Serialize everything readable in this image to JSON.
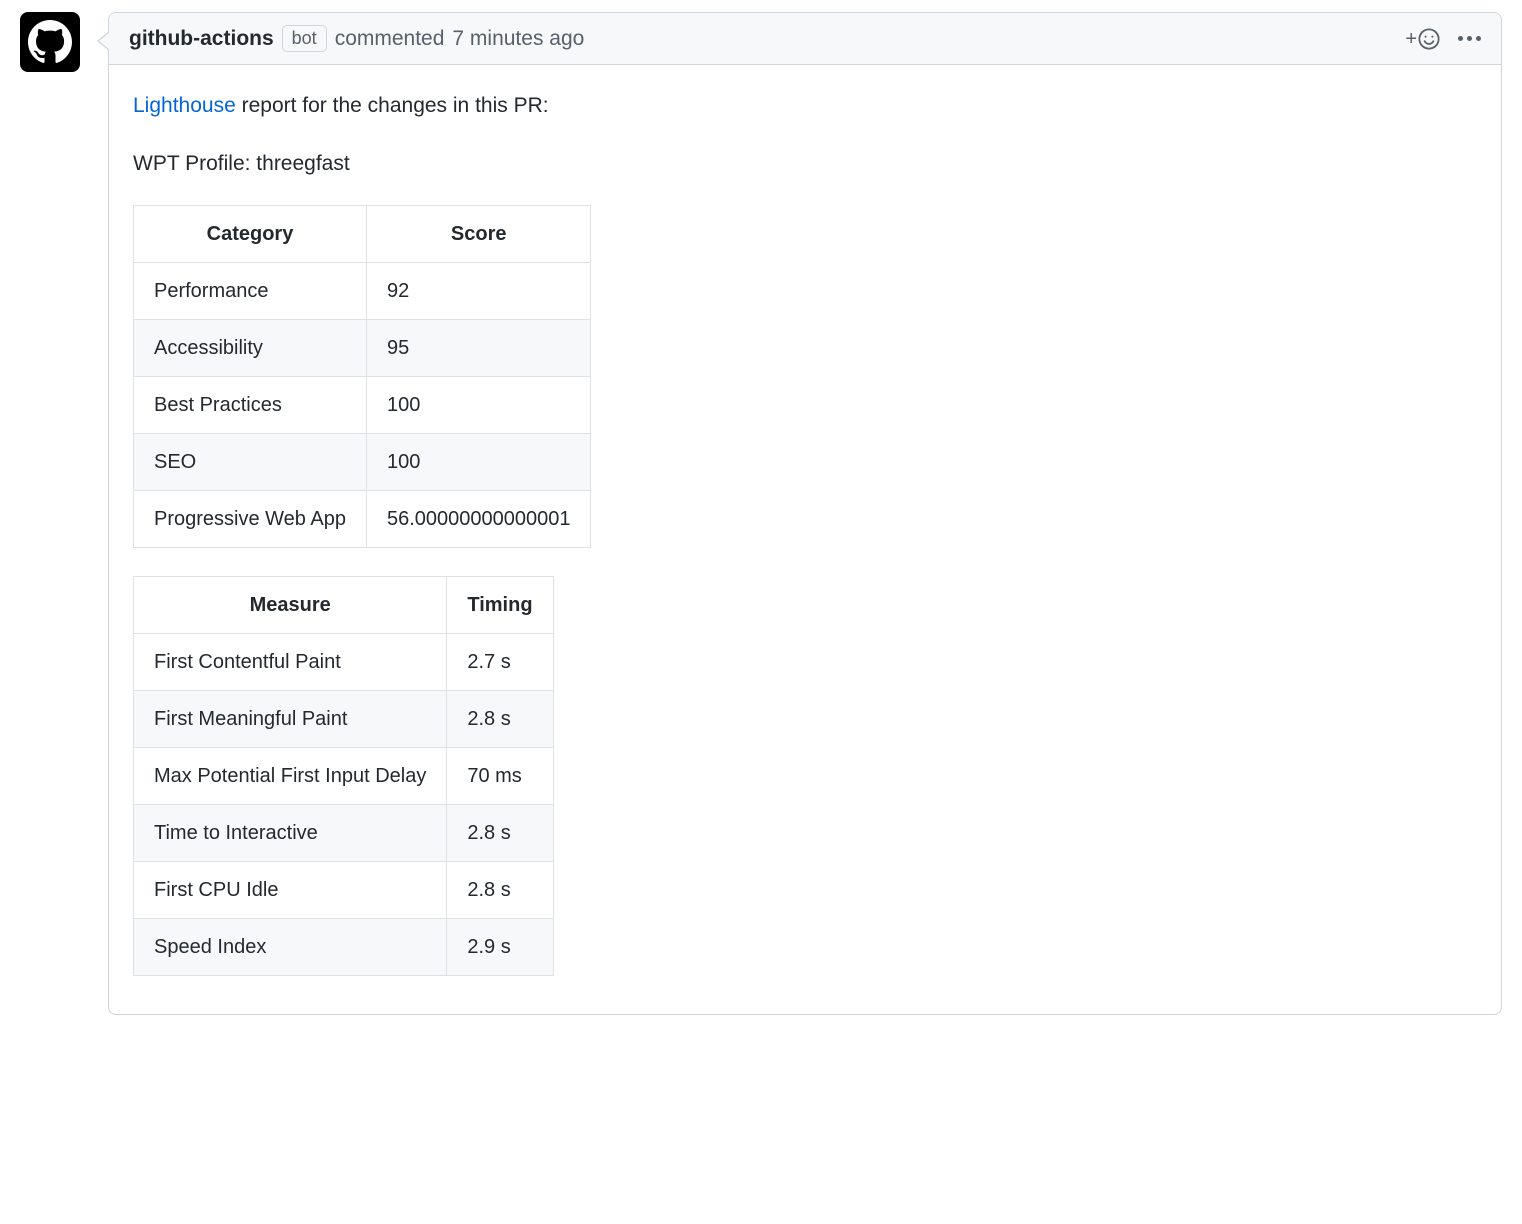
{
  "header": {
    "username": "github-actions",
    "bot_badge": "bot",
    "action_text": "commented",
    "timestamp": "7 minutes ago"
  },
  "body": {
    "link_text": "Lighthouse",
    "report_text": " report for the changes in this PR:",
    "profile_line": "WPT Profile: threegfast",
    "category_table": {
      "headers": [
        "Category",
        "Score"
      ],
      "rows": [
        {
          "c": "Performance",
          "s": "92"
        },
        {
          "c": "Accessibility",
          "s": "95"
        },
        {
          "c": "Best Practices",
          "s": "100"
        },
        {
          "c": "SEO",
          "s": "100"
        },
        {
          "c": "Progressive Web App",
          "s": "56.00000000000001"
        }
      ]
    },
    "timing_table": {
      "headers": [
        "Measure",
        "Timing"
      ],
      "rows": [
        {
          "m": "First Contentful Paint",
          "t": "2.7 s"
        },
        {
          "m": "First Meaningful Paint",
          "t": "2.8 s"
        },
        {
          "m": "Max Potential First Input Delay",
          "t": "70 ms"
        },
        {
          "m": "Time to Interactive",
          "t": "2.8 s"
        },
        {
          "m": "First CPU Idle",
          "t": "2.8 s"
        },
        {
          "m": "Speed Index",
          "t": "2.9 s"
        }
      ]
    }
  }
}
